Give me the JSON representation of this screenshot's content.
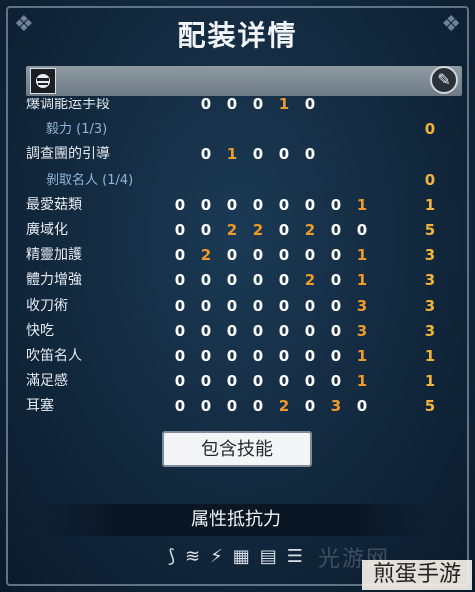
{
  "title": "配装详情",
  "rows": [
    {
      "label": "爆调能运手段",
      "sub": false,
      "values": [
        "0",
        "0",
        "0",
        "1",
        "0"
      ],
      "total": ""
    },
    {
      "label": "毅力 (1/3)",
      "sub": true,
      "values": [],
      "total": "0"
    },
    {
      "label": "調查團的引導",
      "sub": false,
      "values": [
        "0",
        "1",
        "0",
        "0",
        "0"
      ],
      "total": ""
    },
    {
      "label": "剝取名人 (1/4)",
      "sub": true,
      "values": [],
      "total": "0"
    },
    {
      "label": "最愛菇類",
      "sub": false,
      "values": [
        "0",
        "0",
        "0",
        "0",
        "0",
        "0",
        "0",
        "1"
      ],
      "total": "1"
    },
    {
      "label": "廣域化",
      "sub": false,
      "values": [
        "0",
        "0",
        "2",
        "2",
        "0",
        "2",
        "0",
        "0"
      ],
      "total": "5"
    },
    {
      "label": "精靈加護",
      "sub": false,
      "values": [
        "0",
        "2",
        "0",
        "0",
        "0",
        "0",
        "0",
        "1"
      ],
      "total": "3"
    },
    {
      "label": "體力增強",
      "sub": false,
      "values": [
        "0",
        "0",
        "0",
        "0",
        "0",
        "2",
        "0",
        "1"
      ],
      "total": "3"
    },
    {
      "label": "收刀術",
      "sub": false,
      "values": [
        "0",
        "0",
        "0",
        "0",
        "0",
        "0",
        "0",
        "3"
      ],
      "total": "3"
    },
    {
      "label": "快吃",
      "sub": false,
      "values": [
        "0",
        "0",
        "0",
        "0",
        "0",
        "0",
        "0",
        "3"
      ],
      "total": "3"
    },
    {
      "label": "吹笛名人",
      "sub": false,
      "values": [
        "0",
        "0",
        "0",
        "0",
        "0",
        "0",
        "0",
        "1"
      ],
      "total": "1"
    },
    {
      "label": "滿足感",
      "sub": false,
      "values": [
        "0",
        "0",
        "0",
        "0",
        "0",
        "0",
        "0",
        "1"
      ],
      "total": "1"
    },
    {
      "label": "耳塞",
      "sub": false,
      "values": [
        "0",
        "0",
        "0",
        "0",
        "2",
        "0",
        "3",
        "0"
      ],
      "total": "5"
    }
  ],
  "include_skills_button": "包含技能",
  "section_title": "属性抵抗力",
  "element_icons": [
    "fire-icon",
    "water-icon",
    "thunder-icon",
    "ice-icon",
    "dragon-icon",
    "sheet-icon"
  ],
  "watermark": "煎蛋手游",
  "watermark_faint": "光游网"
}
